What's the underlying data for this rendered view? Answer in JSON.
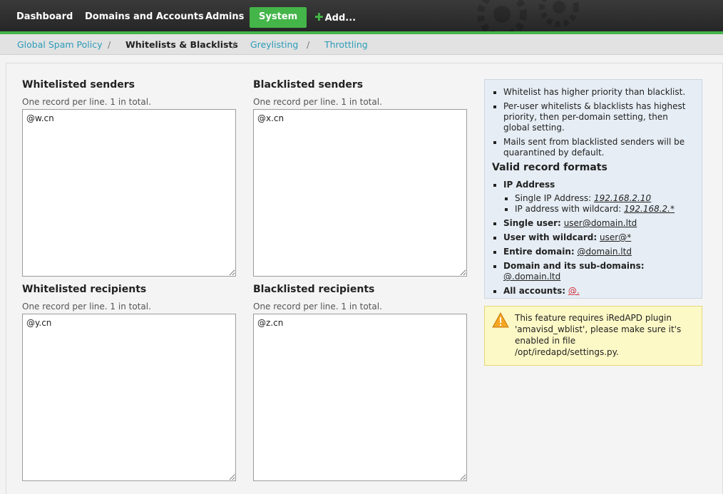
{
  "nav": {
    "items": [
      "Dashboard",
      "Domains and Accounts",
      "Admins",
      "System"
    ],
    "add_label": "Add...",
    "active": "System",
    "accent_color": "#44b549"
  },
  "breadcrumb": {
    "items": [
      "Global Spam Policy",
      "Whitelists & Blacklists",
      "Greylisting",
      "Throttling"
    ],
    "current": "Whitelists & Blacklists",
    "separator": "/"
  },
  "fields": {
    "whitelisted_senders": {
      "title": "Whitelisted senders",
      "hint": "One record per line. 1 in total.",
      "value": "@w.cn"
    },
    "blacklisted_senders": {
      "title": "Blacklisted senders",
      "hint": "One record per line. 1 in total.",
      "value": "@x.cn"
    },
    "whitelisted_recipients": {
      "title": "Whitelisted recipients",
      "hint": "One record per line. 1 in total.",
      "value": "@y.cn"
    },
    "blacklisted_recipients": {
      "title": "Blacklisted recipients",
      "hint": "One record per line. 1 in total.",
      "value": "@z.cn"
    }
  },
  "info": {
    "tips": [
      "Whitelist has higher priority than blacklist.",
      "Per-user whitelists & blacklists has highest priority, then per-domain setting, then global setting.",
      "Mails sent from blacklisted senders will be quarantined by default."
    ],
    "formats_title": "Valid record formats",
    "ip_label": "IP Address",
    "single_ip_label": "Single IP Address:",
    "single_ip_value": "192.168.2.10",
    "wildcard_ip_label": "IP address with wildcard:",
    "wildcard_ip_value": "192.168.2.*",
    "single_user_label": "Single user:",
    "single_user_value": "user@domain.ltd",
    "user_wildcard_label": "User with wildcard:",
    "user_wildcard_value": "user@*",
    "entire_domain_label": "Entire domain:",
    "entire_domain_value": "@domain.ltd",
    "subdomains_label": "Domain and its sub-domains:",
    "subdomains_value": "@.domain.ltd",
    "all_accounts_label": "All accounts:",
    "all_accounts_value": "@."
  },
  "warning": {
    "icon": "warning-triangle-icon",
    "text_line1": "This feature requires iRedAPD plugin",
    "text_line2": "'amavisd_wblist', please make sure it's",
    "text_line3": "enabled in file",
    "text_line4": "/opt/iredapd/settings.py."
  }
}
